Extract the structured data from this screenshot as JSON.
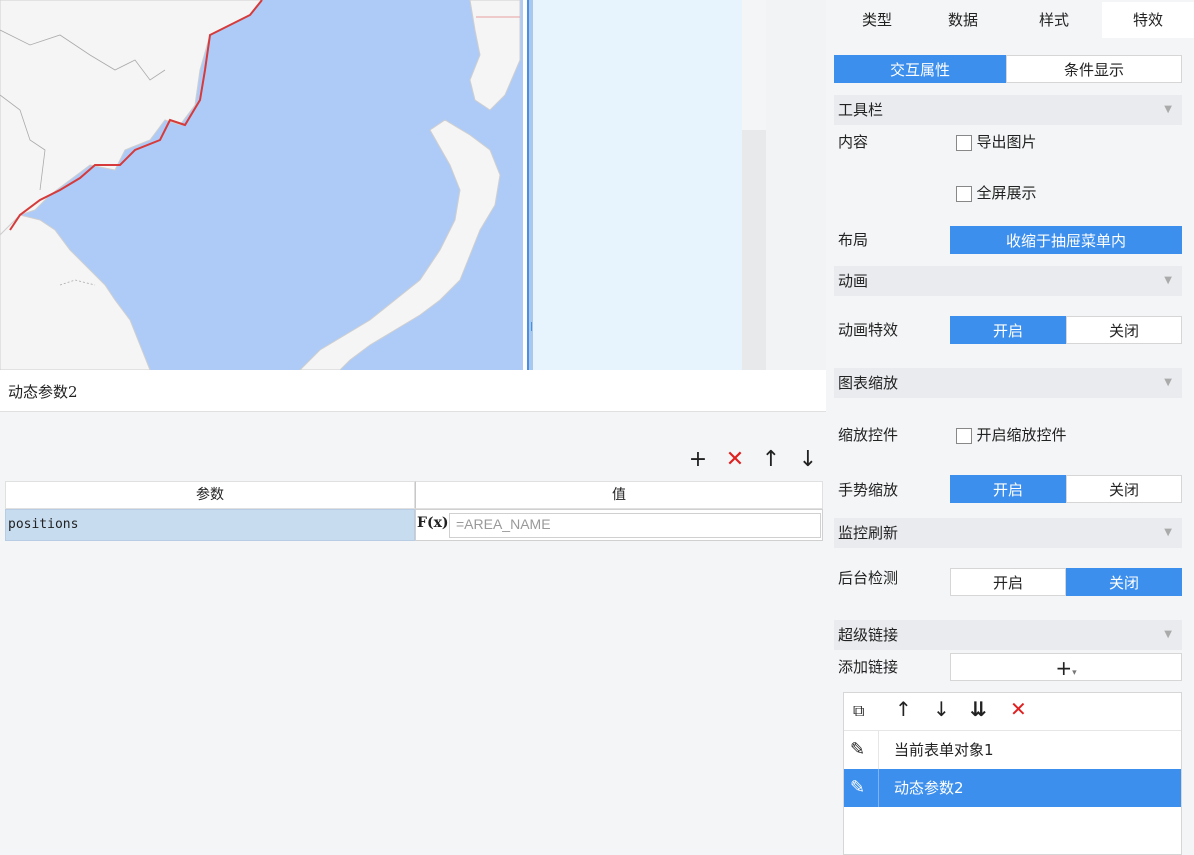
{
  "params_panel": {
    "title": "动态参数2",
    "toolbar": {
      "add": "+",
      "delete": "✕",
      "move_up": "↑",
      "move_down": "↓"
    },
    "columns": [
      "参数",
      "值"
    ],
    "rows": [
      {
        "param": "positions",
        "fx": "F(x)",
        "value": "=AREA_NAME"
      }
    ]
  },
  "right_panel": {
    "tabs": [
      "类型",
      "数据",
      "样式",
      "特效"
    ],
    "active_tab": "特效",
    "subtabs": [
      "交互属性",
      "条件显示"
    ],
    "active_subtab": "交互属性",
    "toolbar_section": {
      "title": "工具栏",
      "content_label": "内容",
      "export_image": "导出图片",
      "fullscreen": "全屏展示",
      "layout_label": "布局",
      "layout_value": "收缩于抽屉菜单内"
    },
    "animation_section": {
      "title": "动画",
      "effect_label": "动画特效",
      "on": "开启",
      "off": "关闭"
    },
    "zoom_section": {
      "title": "图表缩放",
      "control_label": "缩放控件",
      "control_checkbox": "开启缩放控件",
      "gesture_label": "手势缩放",
      "on": "开启",
      "off": "关闭"
    },
    "monitor_section": {
      "title": "监控刷新",
      "detect_label": "后台检测",
      "on": "开启",
      "off": "关闭"
    },
    "hyperlink_section": {
      "title": "超级链接",
      "add_label": "添加链接",
      "add_button": "+",
      "items": [
        "当前表单对象1",
        "动态参数2"
      ],
      "selected_item": "动态参数2"
    }
  },
  "colors": {
    "accent": "#3d8fee",
    "delete": "#e02020",
    "map_sea": "#aecbf7",
    "map_land": "#f5f5f5",
    "border_line": "#d63a3a"
  }
}
